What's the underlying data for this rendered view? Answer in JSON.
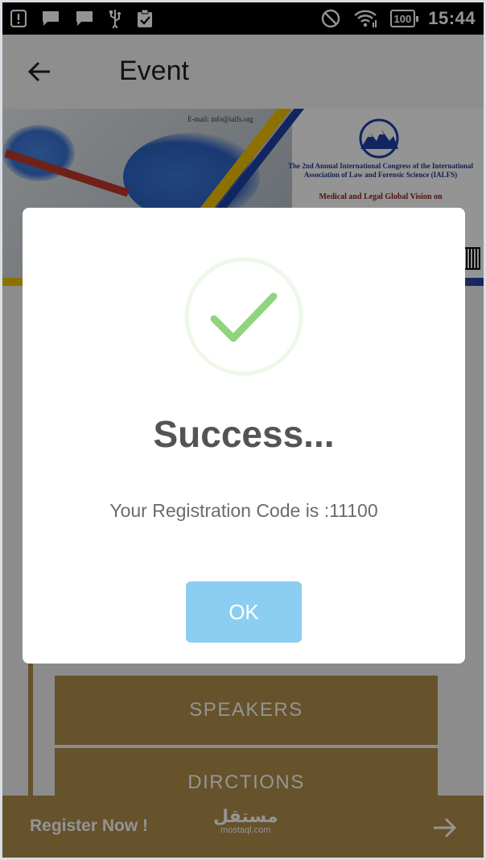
{
  "status_bar": {
    "time": "15:44",
    "battery": "100",
    "icons_left": [
      "alert-icon",
      "message-icon",
      "message-icon",
      "usb-icon",
      "clipboard-check-icon"
    ],
    "icons_right": [
      "do-not-disturb-icon",
      "wifi-icon",
      "battery-icon"
    ]
  },
  "app_bar": {
    "title": "Event",
    "back_icon": "arrow-left-icon"
  },
  "banner": {
    "email": "E-mail: info@ialfs.org",
    "congress_text": "The 2nd Annual International Congress of the International Association of Law and Forensic Science (IALFS)",
    "subtitle": "Medical and Legal Global Vision on"
  },
  "menu": {
    "items": [
      {
        "label": "SPEAKERS"
      },
      {
        "label": "DIRCTIONS"
      }
    ]
  },
  "bottom_bar": {
    "register_label": "Register Now !",
    "arrow_icon": "arrow-right-icon",
    "watermark_arabic": "مستقل",
    "watermark_latin": "mostaql.com"
  },
  "dialog": {
    "title": "Success...",
    "message": "Your Registration Code is :11100",
    "ok_label": "OK",
    "icon": "check-circle-icon"
  },
  "colors": {
    "accent_gold": "#b08d4a",
    "ok_button": "#8ccdf2",
    "success_check": "#8fd47e"
  }
}
